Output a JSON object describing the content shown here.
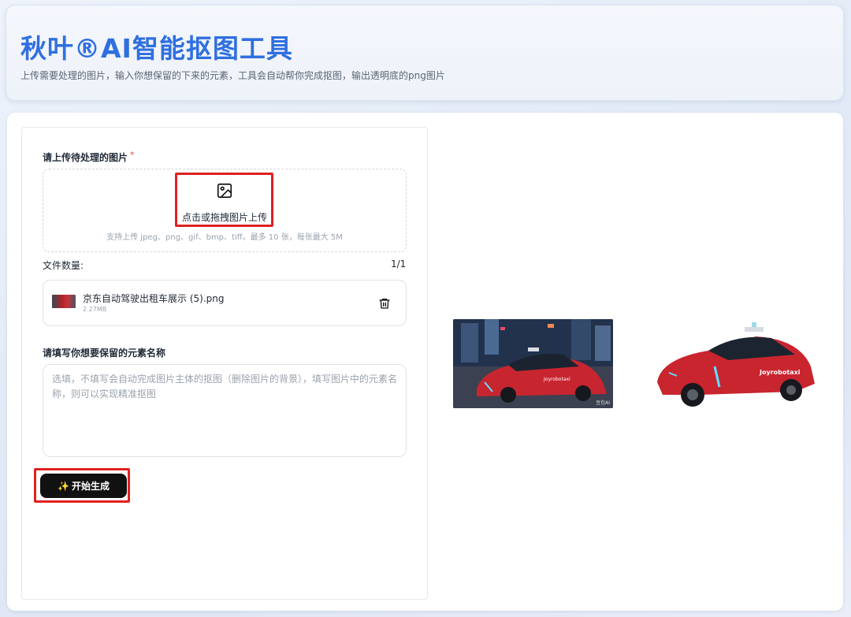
{
  "header": {
    "title": "秋叶®AI智能抠图工具",
    "subtitle": "上传需要处理的图片，输入你想保留的下来的元素，工具会自动帮你完成抠图，输出透明底的png图片"
  },
  "upload": {
    "label": "请上传待处理的图片",
    "required_mark": "*",
    "icon": "image-icon",
    "action_text": "点击或拖拽图片上传",
    "hint": "支持上传 jpeg、png、gif、bmp、tiff。最多 10 张，每张最大 5M"
  },
  "files": {
    "count_label": "文件数量:",
    "count_value": "1/1",
    "items": [
      {
        "name": "京东自动驾驶出租车展示 (5).png",
        "size": "2.27MB",
        "delete_icon": "trash-icon"
      }
    ]
  },
  "element": {
    "label": "请填写你想要保留的元素名称",
    "placeholder": "选填，不填写会自动完成图片主体的抠图（删除图片的背景），填写图片中的元素名称，则可以实现精准抠图",
    "value": ""
  },
  "generate": {
    "icon": "sparkle-icon",
    "spark": "✨",
    "label": "开始生成"
  },
  "preview": {
    "original_watermark": "豆包AI",
    "car_brand_text": "Joyrobotaxi"
  },
  "colors": {
    "title": "#2f6fe0",
    "highlight": "#e02020",
    "button": "#111111"
  }
}
